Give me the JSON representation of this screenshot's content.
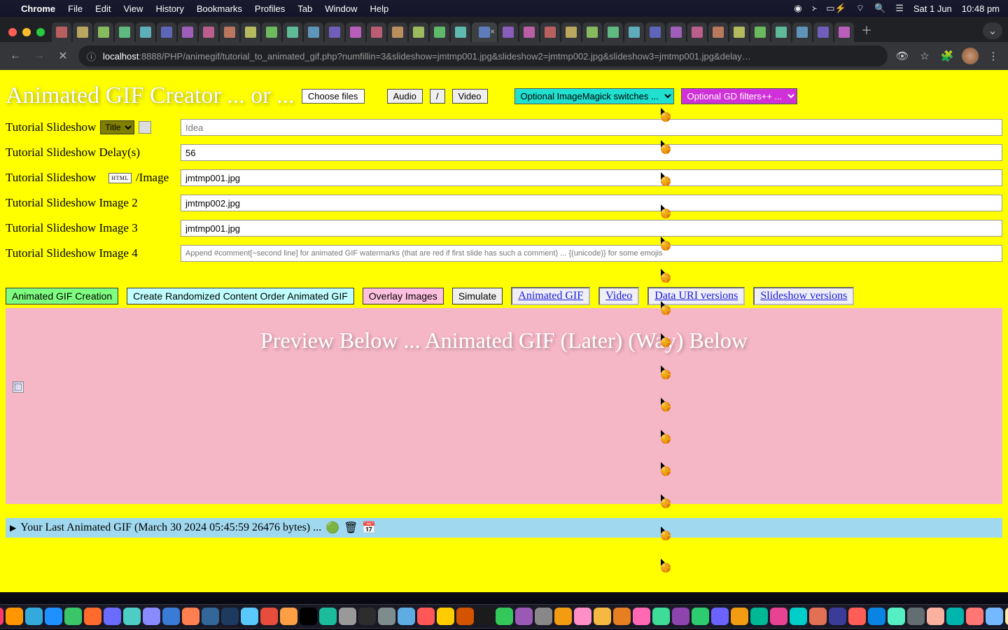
{
  "menubar": {
    "app": "Chrome",
    "items": [
      "File",
      "Edit",
      "View",
      "History",
      "Bookmarks",
      "Profiles",
      "Tab",
      "Window",
      "Help"
    ],
    "date": "Sat 1 Jun",
    "time": "10:48 pm"
  },
  "browser": {
    "url_host": "localhost",
    "url_port": ":8888",
    "url_path": "/PHP/animegif/tutorial_to_animated_gif.php?numfillin=3&slideshow=jmtmp001.jpg&slideshow2=jmtmp002.jpg&slideshow3=jmtmp001.jpg&delay…"
  },
  "page": {
    "title": "Animated GIF Creator ... or ...",
    "choose_files": "Choose files",
    "audio_btn": "Audio",
    "slash_btn": "/",
    "video_btn": "Video",
    "sel_im": "Optional ImageMagick switches ... ",
    "sel_gd": "Optional GD filters++ ... ",
    "rows": [
      {
        "label": "Tutorial Slideshow",
        "extra": "title-select",
        "title_sel": "Title",
        "value": "",
        "placeholder": "Idea"
      },
      {
        "label": "Tutorial Slideshow Delay(s)",
        "value": "56"
      },
      {
        "label": "Tutorial Slideshow",
        "extra": "html",
        "suffix": "/Image",
        "html_box": "HTML",
        "value": "jmtmp001.jpg"
      },
      {
        "label": "Tutorial Slideshow Image 2",
        "value": "jmtmp002.jpg"
      },
      {
        "label": "Tutorial Slideshow Image 3",
        "value": "jmtmp001.jpg"
      },
      {
        "label": "Tutorial Slideshow Image 4",
        "value": "",
        "placeholder": "Append #comment[~second line] for animated GIF watermarks (that are red if first slide has such a comment) ... {(unicode)} for some emojis"
      }
    ],
    "actions": {
      "create": "Animated GIF Creation",
      "random": "Create Randomized Content Order Animated GIF",
      "overlay": "Overlay Images",
      "simulate": "Simulate",
      "link_gif": "Animated GIF",
      "link_video": "Video",
      "link_data": "Data URI versions",
      "link_slide": "Slideshow versions"
    },
    "preview_heading": "Preview Below ... Animated GIF (Later) (Way) Below",
    "details": "Your Last Animated GIF (March 30 2024 05:45:59 26476 bytes) ..."
  },
  "dock_colors": [
    "#c9d6e8",
    "#ff3b6b",
    "#ff9500",
    "#34aadc",
    "#1e90ff",
    "#3ac569",
    "#ff6b2d",
    "#6b6bff",
    "#4ecdc4",
    "#8a8aff",
    "#3a7bd5",
    "#ff7f50",
    "#336699",
    "#1e3a5f",
    "#5ac8fa",
    "#e74c3c",
    "#ff9f43",
    "#000000",
    "#1abc9c",
    "#999999",
    "#2d2d2d",
    "#7f8c8d",
    "#5dade2",
    "#ff5757",
    "#ffcc00",
    "#d35400",
    "#1b1b1b",
    "#34c759",
    "#9b59b6",
    "#888888",
    "#f39c12",
    "#ff8fc7",
    "#f5b841",
    "#e67e22",
    "#ff69b4",
    "#3ddc97",
    "#8e44ad",
    "#2ecc71",
    "#6c63ff",
    "#f39c12",
    "#00b894",
    "#e84393",
    "#00cec9",
    "#e17055",
    "#3b3b98",
    "#ff5e57",
    "#0984e3",
    "#55efc4",
    "#636e72",
    "#fab1a0",
    "#00b5ad",
    "#ff7675",
    "#74b9ff",
    "#ffeaa7",
    "#b2bec3"
  ]
}
